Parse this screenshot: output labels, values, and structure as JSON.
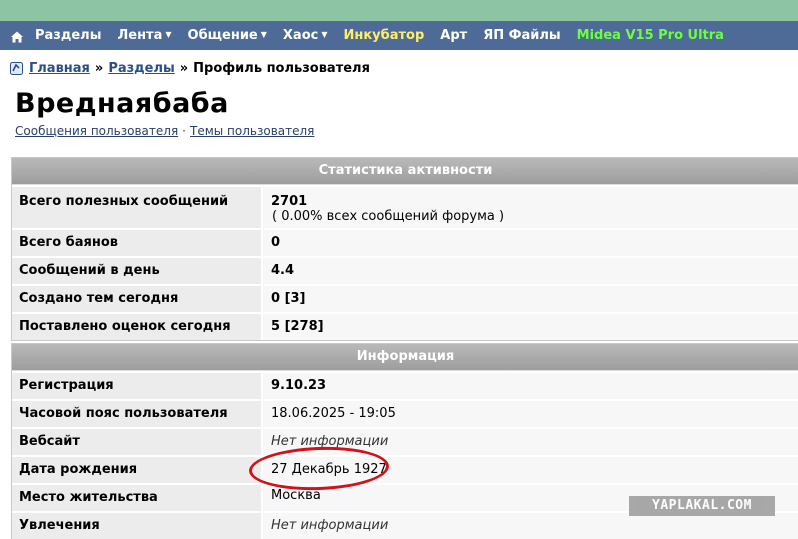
{
  "nav": {
    "items": [
      {
        "label": "Разделы",
        "caret": false
      },
      {
        "label": "Лента",
        "caret": true
      },
      {
        "label": "Общение",
        "caret": true
      },
      {
        "label": "Хаос",
        "caret": true
      },
      {
        "label": "Инкубатор",
        "caret": false
      },
      {
        "label": "Арт",
        "caret": false
      },
      {
        "label": "ЯП Файлы",
        "caret": false
      },
      {
        "label": "Midea V15 Pro Ultra",
        "caret": false
      }
    ]
  },
  "breadcrumb": {
    "home": "Главная",
    "sep": "»",
    "sections": "Разделы",
    "current": "Профиль пользователя"
  },
  "profile": {
    "name": "Вреднаябаба",
    "link_posts": "Сообщения пользователя",
    "link_dot": "·",
    "link_topics": "Темы пользователя"
  },
  "stats": {
    "header": "Статистика активности",
    "rows": [
      {
        "key": "Всего полезных сообщений",
        "value": "2701",
        "sub": "( 0.00% всех сообщений форума )"
      },
      {
        "key": "Всего баянов",
        "value": "0"
      },
      {
        "key": "Сообщений в день",
        "value": "4.4"
      },
      {
        "key": "Создано тем сегодня",
        "value": "0 [3]"
      },
      {
        "key": "Поставлено оценок сегодня",
        "value": "5 [278]"
      }
    ]
  },
  "info": {
    "header": "Информация",
    "rows": [
      {
        "key": "Регистрация",
        "value": "9.10.23"
      },
      {
        "key": "Часовой пояс пользователя",
        "value": "18.06.2025 - 19:05"
      },
      {
        "key": "Вебсайт",
        "value": "Нет информации"
      },
      {
        "key": "Дата рождения",
        "value": "27 Декабрь 1927"
      },
      {
        "key": "Место жительства",
        "value": "Москва"
      },
      {
        "key": "Увлечения",
        "value": "Нет информации"
      }
    ]
  },
  "watermark": "YAPLAKAL.COM",
  "colors": {
    "nav_bg": "#4e6b98",
    "top_strip": "#8dc4a3",
    "incubator": "#ffef66",
    "promo": "#6dff3f",
    "annotation": "#d0121a"
  }
}
